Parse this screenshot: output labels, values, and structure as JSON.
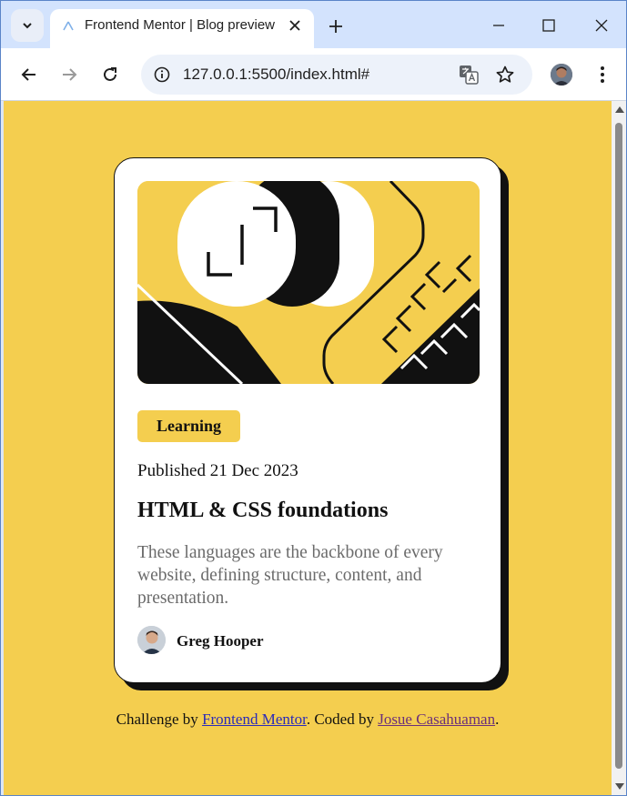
{
  "browser": {
    "tab_title": "Frontend Mentor | Blog preview",
    "url": "127.0.0.1:5500/index.html#"
  },
  "card": {
    "category": "Learning",
    "published": "Published 21 Dec 2023",
    "title": "HTML & CSS foundations",
    "description": "These languages are the backbone of every website, defining structure, content, and presentation.",
    "author": "Greg Hooper"
  },
  "attribution": {
    "prefix": "Challenge by",
    "link1": "Frontend Mentor",
    "middle": ". Coded by",
    "link2": "Josue Casahuaman",
    "suffix": "."
  },
  "colors": {
    "page_background": "#f4ce4f",
    "card": "#ffffff",
    "accent": "#f4ce4f",
    "ink": "#111111"
  }
}
